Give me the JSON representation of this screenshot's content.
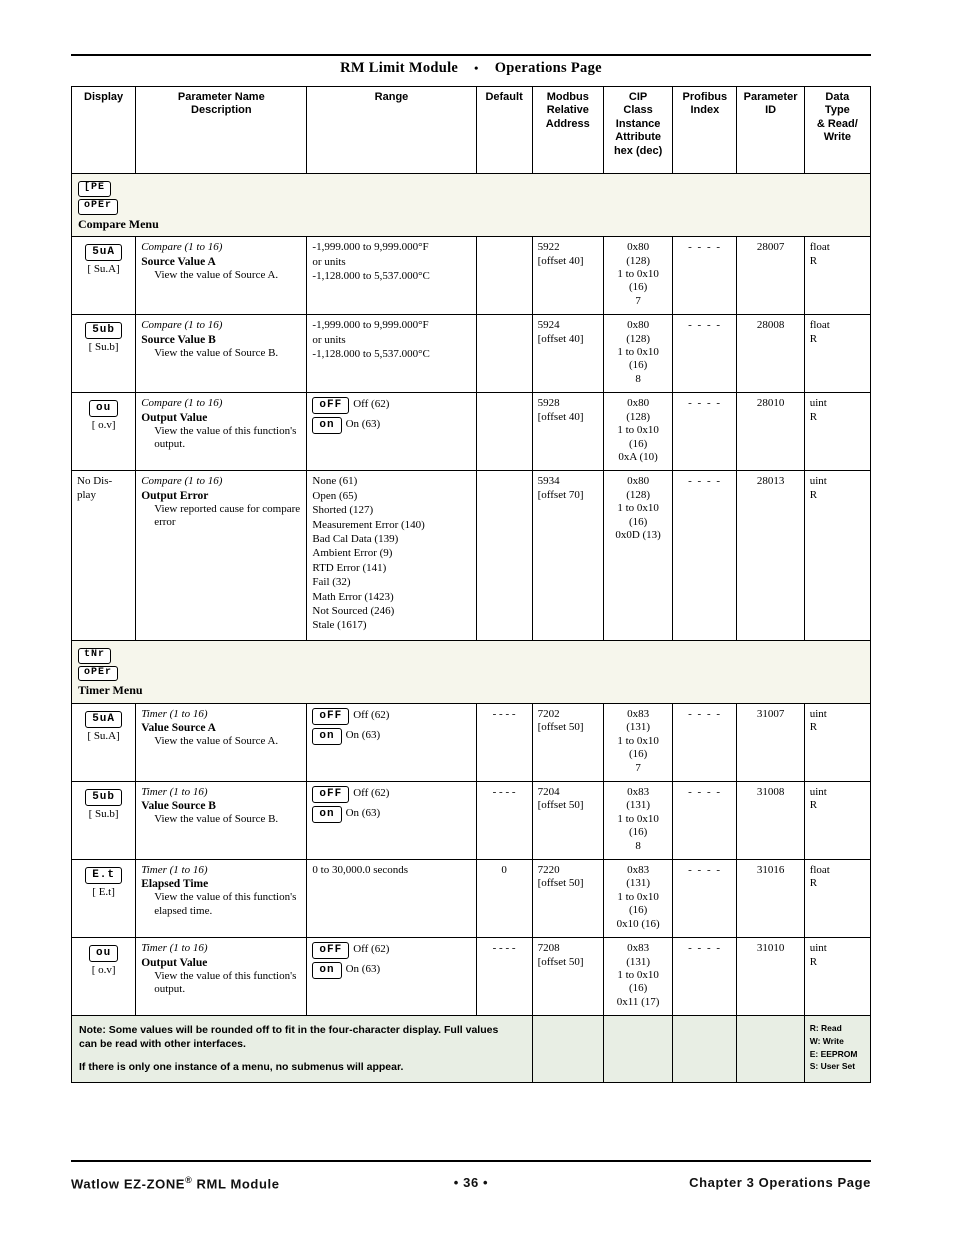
{
  "header": {
    "title_left": "RM Limit Module",
    "separator": "•",
    "title_right": "Operations Page"
  },
  "table": {
    "columns": [
      "Display",
      "Parameter Name\nDescription",
      "Range",
      "Default",
      "Modbus\nRelative\nAddress",
      "CIP\nClass\nInstance\nAttribute\nhex (dec)",
      "Profibus\nIndex",
      "Parameter\nID",
      "Data\nType\n& Read/\nWrite"
    ],
    "col_display": "Display",
    "col_param_1": "Parameter Name",
    "col_param_2": "Description",
    "col_range": "Range",
    "col_default": "Default",
    "col_modbus_1": "Modbus",
    "col_modbus_2": "Relative",
    "col_modbus_3": "Address",
    "col_cip_1": "CIP",
    "col_cip_2": "Class",
    "col_cip_3": "Instance",
    "col_cip_4": "Attribute",
    "col_cip_5": "hex (dec)",
    "col_profibus_1": "Profibus",
    "col_profibus_2": "Index",
    "col_paramid_1": "Parameter",
    "col_paramid_2": "ID",
    "col_data_1": "Data",
    "col_data_2": "Type",
    "col_data_3": "& Read/",
    "col_data_4": "Write"
  },
  "menus": {
    "compare": {
      "disp_line1": "[PE",
      "disp_line2": "oPEr",
      "name": "Compare Menu"
    },
    "timer": {
      "disp_line1": "tNr",
      "disp_line2": "oPEr",
      "name": "Timer Menu"
    }
  },
  "rows": [
    {
      "display_seg": "5uA",
      "display_alt": "[ Su.A]",
      "menu": "Compare (1 to 16)",
      "name": "Source Value A",
      "desc": "View the value of Source A.",
      "range_lines": [
        "-1,999.000 to 9,999.000°F",
        "or units",
        "-1,128.000 to 5,537.000°C"
      ],
      "default": "",
      "modbus_1": "5922",
      "modbus_2": "[offset 40]",
      "cip": [
        "0x80",
        "(128)",
        "1 to 0x10",
        "(16)",
        "7"
      ],
      "profibus": "- - - -",
      "param_id": "28007",
      "data_type": "float",
      "data_rw": "R"
    },
    {
      "display_seg": "5ub",
      "display_alt": "[ Su.b]",
      "menu": "Compare (1 to 16)",
      "name": "Source Value B",
      "desc": "View the value of Source B.",
      "range_lines": [
        "-1,999.000 to 9,999.000°F",
        "or units",
        "-1,128.000 to 5,537.000°C"
      ],
      "default": "",
      "modbus_1": "5924",
      "modbus_2": "[offset 40]",
      "cip": [
        "0x80",
        "(128)",
        "1 to 0x10",
        "(16)",
        "8"
      ],
      "profibus": "- - - -",
      "param_id": "28008",
      "data_type": "float",
      "data_rw": "R"
    },
    {
      "display_seg": "ou",
      "display_alt": "[ o.v]",
      "menu": "Compare (1 to 16)",
      "name": "Output Value",
      "desc": "View the value of this function's output.",
      "range_options": [
        {
          "seg": "oFF",
          "label": "Off (62)"
        },
        {
          "seg": "on",
          "label": "On (63)"
        }
      ],
      "default": "",
      "modbus_1": "5928",
      "modbus_2": "[offset 40]",
      "cip": [
        "0x80",
        "(128)",
        "1 to 0x10",
        "(16)",
        "0xA (10)"
      ],
      "profibus": "- - - -",
      "param_id": "28010",
      "data_type": "uint",
      "data_rw": "R"
    },
    {
      "display_text": "No Dis-play",
      "menu": "Compare (1 to 16)",
      "name": "Output Error",
      "desc": "View reported cause for compare error",
      "range_lines": [
        "None (61)",
        "Open (65)",
        "Shorted (127)",
        "Measurement Error (140)",
        "Bad Cal Data (139)",
        "Ambient Error (9)",
        "RTD Error (141)",
        "Fail (32)",
        "Math Error (1423)",
        "Not Sourced (246)",
        "Stale (1617)"
      ],
      "default": "",
      "modbus_1": "5934",
      "modbus_2": "[offset 70]",
      "cip": [
        "0x80",
        "(128)",
        "1 to 0x10",
        "(16)",
        "0x0D (13)"
      ],
      "profibus": "- - - -",
      "param_id": "28013",
      "data_type": "uint",
      "data_rw": "R"
    },
    {
      "display_seg": "5uA",
      "display_alt": "[ Su.A]",
      "menu": "Timer (1 to 16)",
      "name": "Value Source A",
      "desc": "View the value of Source A.",
      "range_options": [
        {
          "seg": "oFF",
          "label": "Off (62)"
        },
        {
          "seg": "on",
          "label": "On (63)"
        }
      ],
      "default": "- - - -",
      "modbus_1": "7202",
      "modbus_2": "[offset 50]",
      "cip": [
        "0x83",
        "(131)",
        "1 to 0x10",
        "(16)",
        "7"
      ],
      "profibus": "- - - -",
      "param_id": "31007",
      "data_type": "uint",
      "data_rw": "R"
    },
    {
      "display_seg": "5ub",
      "display_alt": "[ Su.b]",
      "menu": "Timer (1 to 16)",
      "name": "Value Source B",
      "desc": "View the value of Source B.",
      "range_options": [
        {
          "seg": "oFF",
          "label": "Off (62)"
        },
        {
          "seg": "on",
          "label": "On (63)"
        }
      ],
      "default": "- - - -",
      "modbus_1": "7204",
      "modbus_2": "[offset 50]",
      "cip": [
        "0x83",
        "(131)",
        "1 to 0x10",
        "(16)",
        "8"
      ],
      "profibus": "- - - -",
      "param_id": "31008",
      "data_type": "uint",
      "data_rw": "R"
    },
    {
      "display_seg": "E.t",
      "display_alt": "[ E.t]",
      "menu": "Timer (1 to 16)",
      "name": "Elapsed Time",
      "desc": "View the value of this function's elapsed time.",
      "range_lines": [
        "0 to 30,000.0 seconds"
      ],
      "default": "0",
      "modbus_1": "7220",
      "modbus_2": "[offset 50]",
      "cip": [
        "0x83",
        "(131)",
        "1 to 0x10",
        "(16)",
        "0x10 (16)"
      ],
      "profibus": "- - - -",
      "param_id": "31016",
      "data_type": "float",
      "data_rw": "R"
    },
    {
      "display_seg": "ou",
      "display_alt": "[ o.v]",
      "menu": "Timer (1 to 16)",
      "name": "Output Value",
      "desc": "View the value of this function's output.",
      "range_options": [
        {
          "seg": "oFF",
          "label": "Off (62)"
        },
        {
          "seg": "on",
          "label": "On (63)"
        }
      ],
      "default": "- - - -",
      "modbus_1": "7208",
      "modbus_2": "[offset 50]",
      "cip": [
        "0x83",
        "(131)",
        "1 to 0x10",
        "(16)",
        "0x11 (17)"
      ],
      "profibus": "- - - -",
      "param_id": "31010",
      "data_type": "uint",
      "data_rw": "R"
    }
  ],
  "note": {
    "line1": "Note: Some values will be rounded off to fit in the four-character display. Full values",
    "line2": "can be read with other interfaces.",
    "line3": "If there is only one instance of a menu, no submenus will appear.",
    "legend": [
      "R: Read",
      "W: Write",
      "E: EEPROM",
      "S: User Set"
    ]
  },
  "footer": {
    "left_1": "Watlow EZ-ZONE",
    "left_sup": "®",
    "left_2": " RML Module",
    "page": "•  36  •",
    "right": "Chapter 3 Operations Page"
  }
}
